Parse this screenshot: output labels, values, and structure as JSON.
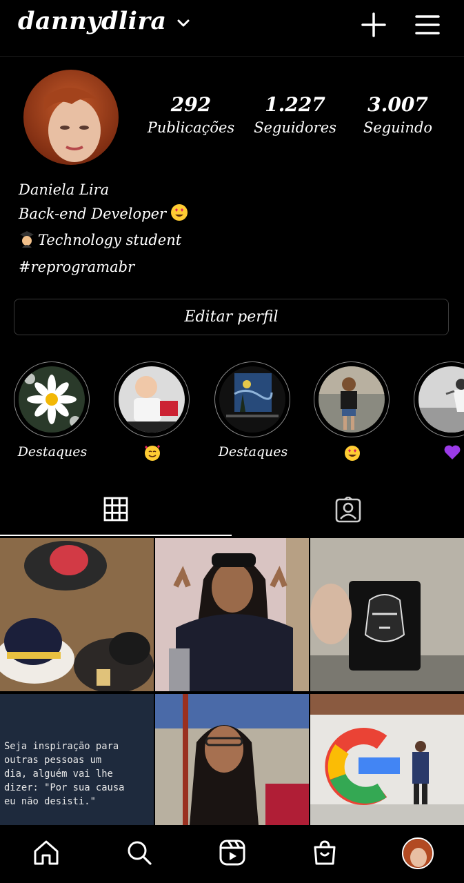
{
  "header": {
    "username": "dannydlira",
    "icons": [
      "chevron-down-icon",
      "plus-icon",
      "menu-icon"
    ]
  },
  "profile": {
    "stats": [
      {
        "value": "292",
        "label": "Publicações"
      },
      {
        "value": "1.227",
        "label": "Seguidores"
      },
      {
        "value": "3.007",
        "label": "Seguindo"
      }
    ],
    "bio": {
      "name": "Daniela Lira",
      "line1": "Back-end Developer",
      "line2": "Technology student",
      "line3": "#reprogramabr"
    },
    "edit_button_label": "Editar perfil"
  },
  "highlights": [
    {
      "label": "Destaques",
      "icon": "daisy-photo"
    },
    {
      "label": "",
      "icon": "smiling-face-with-hearts-emoji"
    },
    {
      "label": "Destaques",
      "icon": "starry-night-photo"
    },
    {
      "label": "",
      "icon": "heart-eyes-emoji"
    },
    {
      "label": "",
      "icon": "purple-heart-emoji"
    }
  ],
  "tabs": [
    {
      "name": "grid",
      "icon": "grid-icon",
      "active": true
    },
    {
      "name": "tagged",
      "icon": "tagged-person-icon",
      "active": false
    }
  ],
  "posts": {
    "quote_text": "Seja inspiração para\noutras pessoas um\ndia, alguém vai lhe\ndizer: \"Por sua causa\neu não desisti.\""
  },
  "bottom_nav": [
    "home-icon",
    "search-icon",
    "reels-icon",
    "shop-icon",
    "profile-avatar"
  ],
  "colors": {
    "background": "#000000",
    "text": "#ffffff",
    "border": "#3a3a3a",
    "quote_bg": "#1e2a3d"
  }
}
